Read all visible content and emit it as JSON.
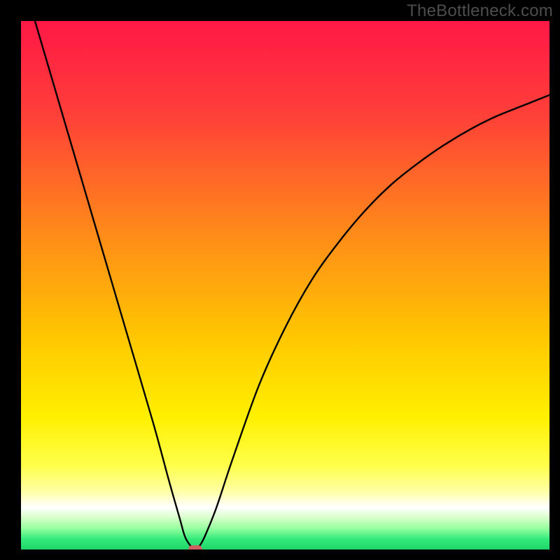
{
  "watermark": {
    "text": "TheBottleneck.com"
  },
  "colors": {
    "frame_bg": "#000000",
    "curve_stroke": "#000000",
    "marker": "#cf6160",
    "gradient_stops": [
      {
        "pct": 0,
        "color": "#ff1846"
      },
      {
        "pct": 18,
        "color": "#ff4038"
      },
      {
        "pct": 40,
        "color": "#ff8a19"
      },
      {
        "pct": 60,
        "color": "#ffc700"
      },
      {
        "pct": 75,
        "color": "#fff000"
      },
      {
        "pct": 84,
        "color": "#ffff4a"
      },
      {
        "pct": 89,
        "color": "#ffffa5"
      },
      {
        "pct": 92,
        "color": "#ffffff"
      },
      {
        "pct": 94,
        "color": "#d8ffca"
      },
      {
        "pct": 96,
        "color": "#96ff9f"
      },
      {
        "pct": 98,
        "color": "#35eb7a"
      },
      {
        "pct": 100,
        "color": "#1fd56a"
      }
    ]
  },
  "chart_data": {
    "type": "line",
    "title": "",
    "xlabel": "",
    "ylabel": "",
    "xlim": [
      0,
      100
    ],
    "ylim": [
      0,
      100
    ],
    "series": [
      {
        "name": "bottleneck-curve",
        "x": [
          0,
          5,
          10,
          15,
          20,
          25,
          28,
          30,
          31,
          32,
          33,
          34,
          35,
          37,
          40,
          45,
          50,
          55,
          60,
          65,
          70,
          75,
          80,
          85,
          90,
          95,
          100
        ],
        "y": [
          109,
          92,
          75,
          58,
          41,
          24,
          13,
          6,
          2.5,
          0.8,
          0,
          1.0,
          3,
          8,
          17,
          31,
          42,
          51,
          58,
          64,
          69,
          73,
          76.5,
          79.5,
          82,
          84,
          86
        ]
      }
    ],
    "annotations": [
      {
        "name": "optimal-point",
        "x": 33,
        "y": 0
      }
    ]
  }
}
